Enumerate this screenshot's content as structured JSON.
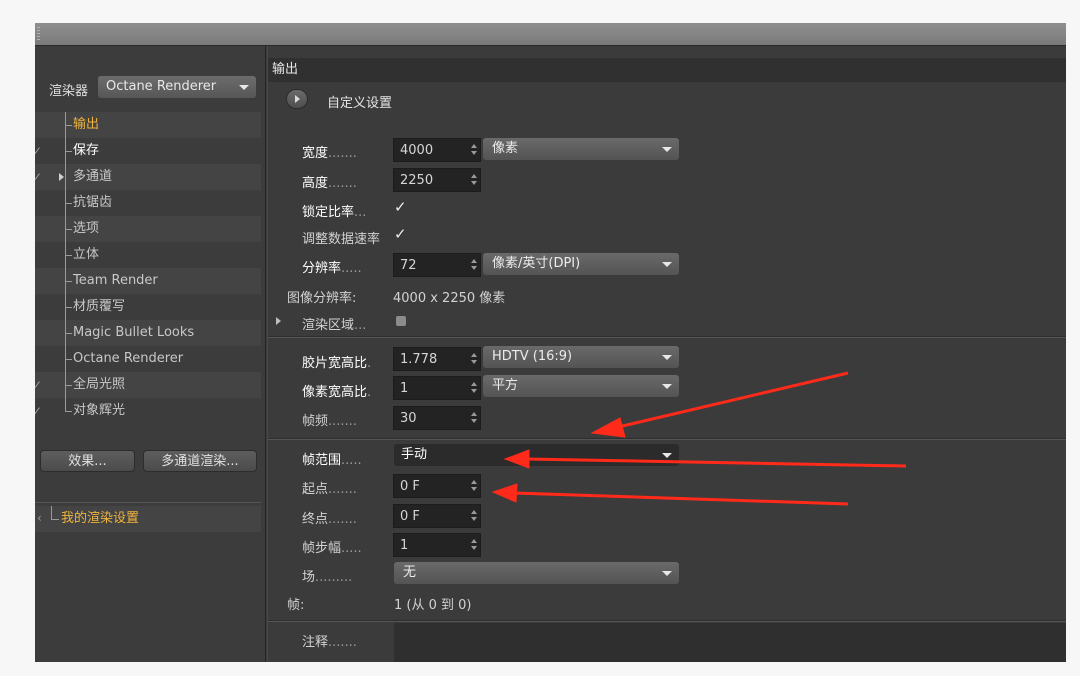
{
  "renderer": {
    "label": "渲染器",
    "selected": "Octane Renderer"
  },
  "sidebar": {
    "items": [
      {
        "label": "输出",
        "state": "active"
      },
      {
        "label": "保存",
        "state": "bright"
      },
      {
        "label": "多通道",
        "state": "normal"
      },
      {
        "label": "抗锯齿",
        "state": "normal"
      },
      {
        "label": "选项",
        "state": "normal"
      },
      {
        "label": "立体",
        "state": "normal"
      },
      {
        "label": "Team Render",
        "state": "normal"
      },
      {
        "label": "材质覆写",
        "state": "normal"
      },
      {
        "label": "Magic Bullet Looks",
        "state": "normal"
      },
      {
        "label": "Octane Renderer",
        "state": "normal"
      },
      {
        "label": "全局光照",
        "state": "normal"
      },
      {
        "label": "对象辉光",
        "state": "normal"
      }
    ],
    "effects_button": "效果...",
    "multipass_button": "多通道渲染...",
    "render_setting": "我的渲染设置"
  },
  "panel": {
    "header": "输出",
    "custom_preset": "自定义设置",
    "width": {
      "label": "宽度",
      "dots": ".......",
      "value": "4000",
      "unit": "像素"
    },
    "height": {
      "label": "高度",
      "dots": ".......",
      "value": "2250"
    },
    "lock_ratio": {
      "label": "锁定比率",
      "dots": "...",
      "mark": "✓"
    },
    "adjust_rate": {
      "label": "调整数据速率",
      "mark": "✓"
    },
    "resolution": {
      "label": "分辨率",
      "dots": ".....",
      "value": "72",
      "unit": "像素/英寸(DPI)"
    },
    "image_resolution": {
      "label": "图像分辨率:",
      "value": "4000 x 2250 像素"
    },
    "render_region": {
      "label": "渲染区域",
      "dots": "..."
    },
    "film_aspect": {
      "label": "胶片宽高比",
      "dots": ".",
      "value": "1.778",
      "preset": "HDTV (16:9)"
    },
    "pixel_aspect": {
      "label": "像素宽高比",
      "dots": ".",
      "value": "1",
      "preset": "平方"
    },
    "frame_rate": {
      "label": "帧频",
      "dots": ".......",
      "value": "30"
    },
    "frame_range": {
      "label": "帧范围",
      "dots": ".....",
      "value": "手动"
    },
    "start": {
      "label": "起点",
      "dots": ".......",
      "value": "0 F"
    },
    "end": {
      "label": "终点",
      "dots": ".......",
      "value": "0 F"
    },
    "frame_step": {
      "label": "帧步幅",
      "dots": ".....",
      "value": "1"
    },
    "field": {
      "label": "场",
      "dots": ".........",
      "value": "无"
    },
    "frames": {
      "label": "帧:",
      "value": "1 (从 0 到 0)"
    },
    "notes": {
      "label": "注释",
      "dots": "......."
    }
  },
  "colors": {
    "accent": "#f0b43c",
    "annotation_arrow": "#ff2a1a"
  }
}
